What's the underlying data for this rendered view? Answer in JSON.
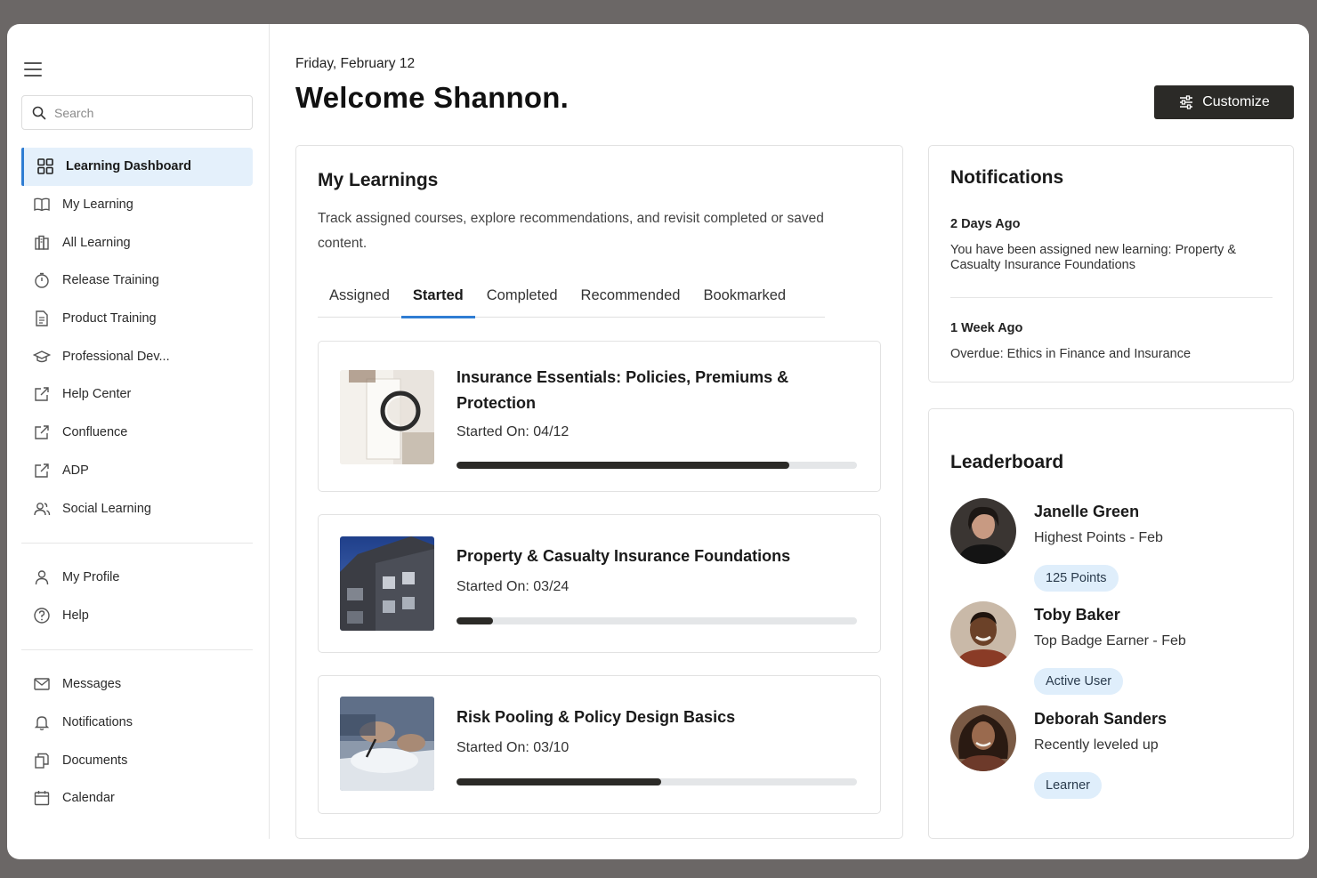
{
  "sidebar": {
    "search_placeholder": "Search",
    "items": [
      {
        "label": "Learning Dashboard",
        "icon": "grid-icon",
        "active": true
      },
      {
        "label": "My Learning",
        "icon": "book-icon"
      },
      {
        "label": "All Learning",
        "icon": "library-icon"
      },
      {
        "label": "Release Training",
        "icon": "timer-icon"
      },
      {
        "label": "Product Training",
        "icon": "document-icon"
      },
      {
        "label": "Professional Dev...",
        "icon": "graduation-cap-icon"
      },
      {
        "label": "Help Center",
        "icon": "external-link-icon"
      },
      {
        "label": "Confluence",
        "icon": "external-link-icon"
      },
      {
        "label": "ADP",
        "icon": "external-link-icon"
      },
      {
        "label": "Social Learning",
        "icon": "users-icon"
      }
    ],
    "account_items": [
      {
        "label": "My Profile",
        "icon": "user-icon"
      },
      {
        "label": "Help",
        "icon": "help-circle-icon"
      }
    ],
    "utility_items": [
      {
        "label": "Messages",
        "icon": "mail-icon"
      },
      {
        "label": "Notifications",
        "icon": "bell-icon"
      },
      {
        "label": "Documents",
        "icon": "documents-icon"
      },
      {
        "label": "Calendar",
        "icon": "calendar-icon"
      }
    ]
  },
  "header": {
    "date": "Friday, February 12",
    "welcome": "Welcome Shannon.",
    "customize_label": "Customize"
  },
  "learnings": {
    "title": "My Learnings",
    "description": "Track assigned courses, explore recommendations, and revisit completed or saved content.",
    "tabs": [
      "Assigned",
      "Started",
      "Completed",
      "Recommended",
      "Bookmarked"
    ],
    "active_tab": "Started",
    "courses": [
      {
        "title": "Insurance Essentials: Policies, Premiums & Protection",
        "started": "Started On: 04/12",
        "progress": 0.83
      },
      {
        "title": "Property & Casualty Insurance Foundations",
        "started": "Started On: 03/24",
        "progress": 0.09
      },
      {
        "title": "Risk Pooling & Policy Design Basics",
        "started": "Started On: 03/10",
        "progress": 0.51
      }
    ]
  },
  "notifications": {
    "title": "Notifications",
    "items": [
      {
        "when": "2 Days Ago",
        "text": "You have been assigned new learning: Property & Casualty Insurance Foundations"
      },
      {
        "when": "1 Week Ago",
        "text": "Overdue: Ethics in Finance and Insurance"
      }
    ]
  },
  "leaderboard": {
    "title": "Leaderboard",
    "entries": [
      {
        "name": "Janelle Green",
        "subtitle": "Highest Points - Feb",
        "badge": "125 Points"
      },
      {
        "name": "Toby Baker",
        "subtitle": "Top Badge Earner - Feb",
        "badge": "Active User"
      },
      {
        "name": "Deborah Sanders",
        "subtitle": "Recently leveled up",
        "badge": "Learner"
      }
    ]
  },
  "colors": {
    "accent": "#2f7dd3",
    "active_bg": "#e4f0fb",
    "dark_button": "#2b2a27",
    "badge_bg": "#dfeefb",
    "progress_fill": "#2b2a27",
    "progress_track": "#e4e6e8"
  }
}
